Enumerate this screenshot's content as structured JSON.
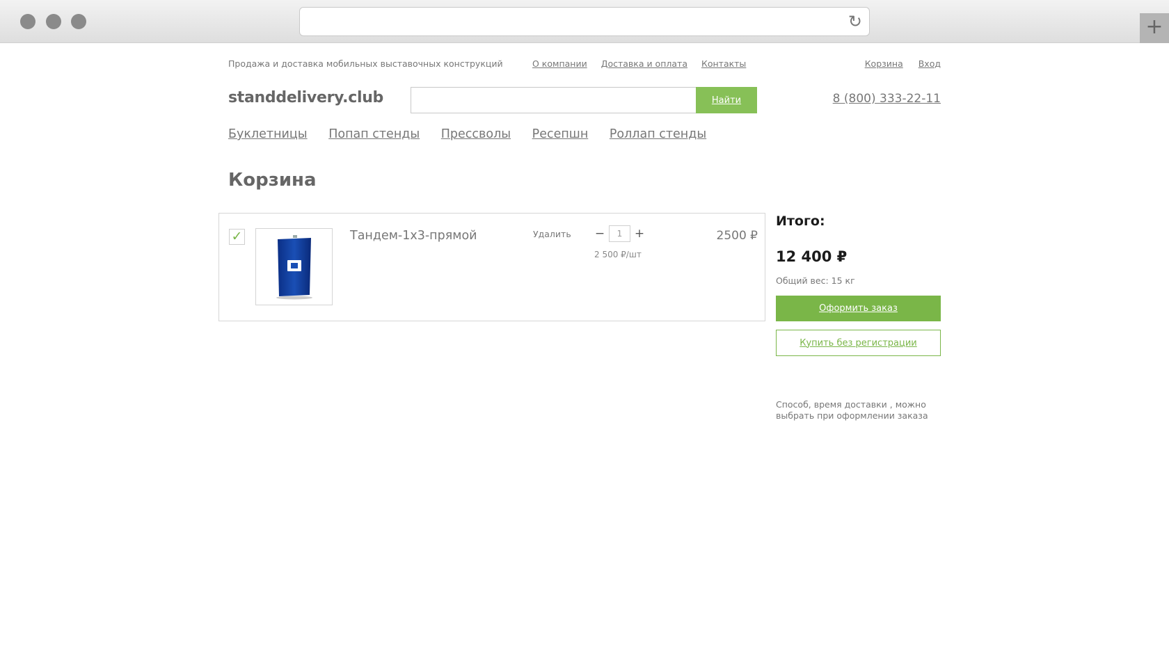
{
  "browser": {
    "url": "",
    "reload_icon": "↻",
    "new_tab_icon": "+"
  },
  "header": {
    "tagline": "Продажа и доставка мобильных выставочных конструкций",
    "nav": [
      "О компании",
      "Доставка и оплата",
      "Контакты"
    ],
    "cart_link": "Корзина",
    "login_link": "Вход",
    "logo": "standdelivery.club",
    "search": {
      "value": "",
      "button": "Найти"
    },
    "phone": "8 (800) 333-22-11"
  },
  "categories": [
    "Буклетницы",
    "Попап стенды",
    "Прессволы",
    "Ресепшн",
    "Роллап стенды"
  ],
  "page": {
    "title": "Корзина"
  },
  "cart": {
    "items": [
      {
        "checked": "✓",
        "name": "Тандем-1x3-прямой",
        "remove_label": "Удалить",
        "quantity": "1",
        "minus": "−",
        "plus": "+",
        "unit_price": "2 500 ₽/шт",
        "total": "2500 ₽",
        "image_icon": "brochure-stand-icon"
      }
    ]
  },
  "summary": {
    "label": "Итого:",
    "total": "12 400 ₽",
    "weight": "Общий вес: 15 кг",
    "order_button": "Оформить заказ",
    "guest_button": "Купить без регистрации",
    "delivery_note": "Способ, время доставки , можно выбрать при оформлении заказа"
  },
  "colors": {
    "accent": "#7ab648",
    "text": "#777777",
    "heading": "#1b1b1b"
  }
}
